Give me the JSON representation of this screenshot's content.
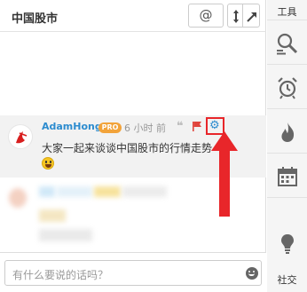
{
  "header": {
    "title": "中国股市",
    "at_label": "@"
  },
  "message": {
    "user": "AdamHong",
    "badge": "PRO",
    "time": "6 小时 前",
    "quote_glyph": "❝",
    "text": "大家一起来谈谈中国股市的行情走势"
  },
  "input": {
    "placeholder": "有什么要说的话吗？"
  },
  "toolbar": {
    "top_label": "工具",
    "bottom_label": "社交",
    "buttons": [
      "search-icon",
      "alarm-icon",
      "flame-icon",
      "calendar-icon",
      "bulb-icon"
    ]
  },
  "colors": {
    "accent": "#2d8ccf",
    "pro_badge": "#f2a33a",
    "highlight": "#e8262a"
  }
}
